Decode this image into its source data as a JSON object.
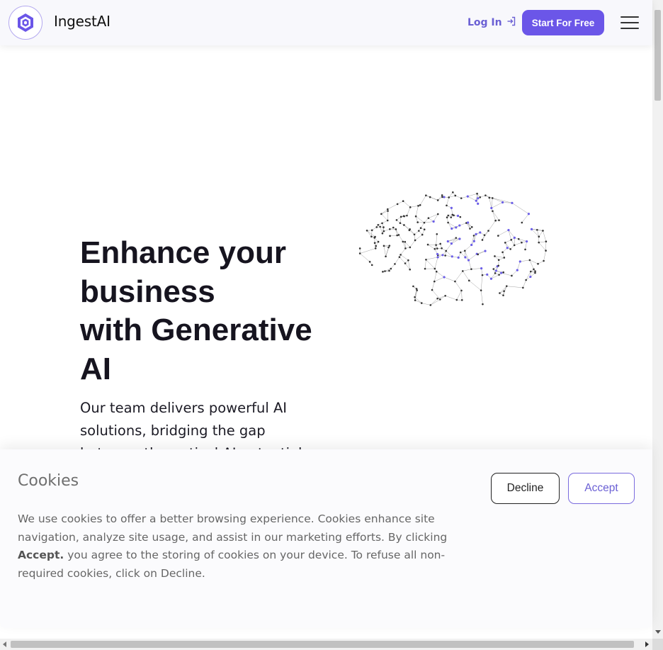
{
  "header": {
    "brand": "IngestAI",
    "login_label": "Log In",
    "start_label": "Start For Free"
  },
  "hero": {
    "title_lines": [
      "Enhance your",
      "business",
      "with Generative",
      "AI"
    ],
    "subtitle_lines": [
      "Our team delivers powerful AI",
      "solutions, bridging the gap",
      "between theoretical AI potential"
    ]
  },
  "cookies": {
    "title": "Cookies",
    "text_before": "We use cookies to offer a better browsing experience. Cookies enhance site navigation, analyze site usage, and assist in our marketing efforts. By clicking",
    "text_bold": "Accept.",
    "text_after": "you agree to the storing of cookies on your device. To refuse all non-required cookies, click on Decline.",
    "decline_label": "Decline",
    "accept_label": "Accept"
  },
  "colors": {
    "accent": "#6b56e8",
    "accent_text": "#6a5fd4",
    "node_dark": "#333333",
    "node_accent": "#6b5ee8"
  },
  "icons": {
    "logo": "hexagon-logo-icon",
    "login": "login-arrow-icon",
    "menu": "hamburger-menu-icon",
    "hero_image": "brain-network-icon"
  }
}
